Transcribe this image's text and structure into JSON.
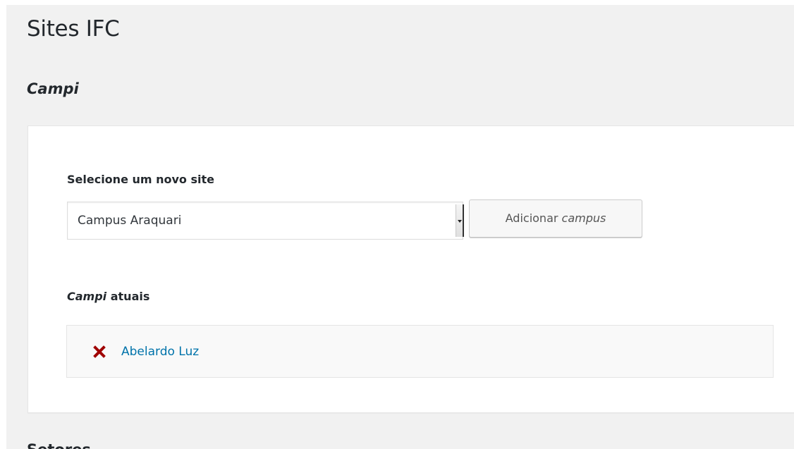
{
  "page": {
    "title": "Sites IFC"
  },
  "campi_section": {
    "title": "Campi",
    "select_label": "Selecione um novo site",
    "select_value": "Campus Araquari",
    "add_button_prefix": "Adicionar",
    "add_button_italic": "campus",
    "current_label_italic": "Campi",
    "current_label_rest": " atuais",
    "current_items": [
      {
        "label": "Abelardo Luz",
        "icon": "remove-x-icon"
      }
    ]
  },
  "next_section": {
    "title": "Setores"
  },
  "colors": {
    "background": "#f1f1f1",
    "card": "#ffffff",
    "link": "#0073aa",
    "remove": "#a00000"
  }
}
